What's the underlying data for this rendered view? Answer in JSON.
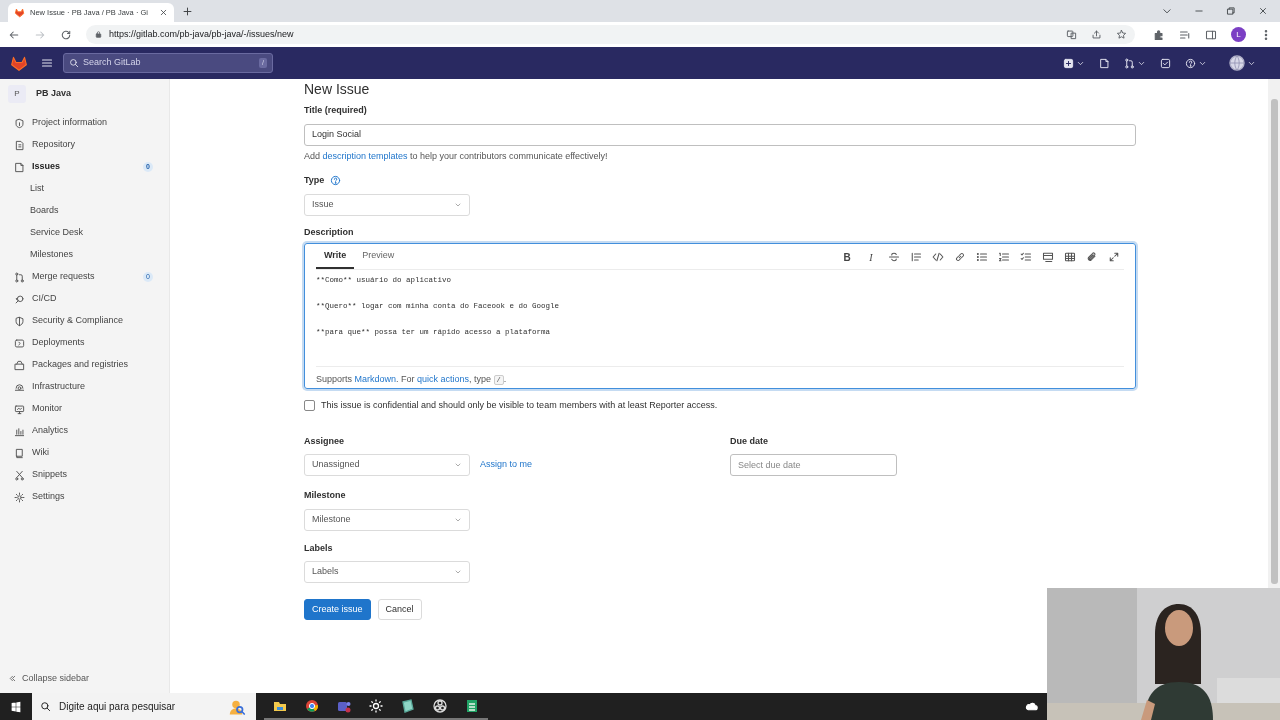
{
  "browser": {
    "tab_title": "New Issue · PB Java / PB Java · Gi",
    "url": "https://gitlab.com/pb-java/pb-java/-/issues/new",
    "profile_initial": "L"
  },
  "header": {
    "search_placeholder": "Search GitLab",
    "search_shortcut": "/"
  },
  "sidebar": {
    "project_initial": "P",
    "project_name": "PB Java",
    "items": [
      {
        "label": "Project information",
        "selected": false
      },
      {
        "label": "Repository",
        "selected": false
      },
      {
        "label": "Issues",
        "selected": true,
        "badge": "0",
        "children": [
          {
            "label": "List",
            "selected": false
          },
          {
            "label": "Boards",
            "selected": false
          },
          {
            "label": "Service Desk",
            "selected": false
          },
          {
            "label": "Milestones",
            "selected": false
          }
        ]
      },
      {
        "label": "Merge requests",
        "selected": false,
        "badge": "0"
      },
      {
        "label": "CI/CD",
        "selected": false
      },
      {
        "label": "Security & Compliance",
        "selected": false
      },
      {
        "label": "Deployments",
        "selected": false
      },
      {
        "label": "Packages and registries",
        "selected": false
      },
      {
        "label": "Infrastructure",
        "selected": false
      },
      {
        "label": "Monitor",
        "selected": false
      },
      {
        "label": "Analytics",
        "selected": false
      },
      {
        "label": "Wiki",
        "selected": false
      },
      {
        "label": "Snippets",
        "selected": false
      },
      {
        "label": "Settings",
        "selected": false
      }
    ],
    "collapse": "Collapse sidebar"
  },
  "page": {
    "heading": "New Issue",
    "title": {
      "label": "Title (required)",
      "value": "Login Social"
    },
    "hint": [
      {
        "text": "Add "
      },
      {
        "text": "description templates",
        "link": true
      },
      {
        "text": " to help your contributors communicate effectively!"
      }
    ],
    "type": {
      "label": "Type",
      "value": "Issue"
    },
    "description": {
      "label": "Description",
      "tabs": [
        {
          "label": "Write",
          "selected": true
        },
        {
          "label": "Preview",
          "selected": false
        }
      ],
      "format_buttons": [
        {
          "kind": "bold",
          "label": "B"
        },
        {
          "kind": "italic",
          "label": "I"
        }
      ],
      "paragraphs": [
        "**Como** usuário do aplicativo",
        "**Quero** logar com minha conta do Faceook e do Google",
        "**para que** possa ter um rápido acesso a plataforma"
      ],
      "footer": [
        {
          "text": "Supports "
        },
        {
          "text": "Markdown",
          "link": true
        },
        {
          "text": ". For "
        },
        {
          "text": "quick actions",
          "link": true
        },
        {
          "text": ", type "
        },
        {
          "text": "/",
          "kbd": true
        },
        {
          "text": "."
        }
      ]
    },
    "confidential": {
      "label": "This issue is confidential and should only be visible to team members with at least Reporter access.",
      "checked": false
    },
    "assignee": {
      "label": "Assignee",
      "value": "Unassigned",
      "assign_link": "Assign to me"
    },
    "due_date": {
      "label": "Due date",
      "placeholder": "Select due date"
    },
    "milestone": {
      "label": "Milestone",
      "value": "Milestone"
    },
    "labels": {
      "label": "Labels",
      "value": "Labels"
    },
    "buttons": [
      {
        "kind": "primary",
        "label": "Create issue"
      },
      {
        "kind": "secondary",
        "label": "Cancel"
      }
    ]
  },
  "taskbar": {
    "search_placeholder": "Digite aqui para pesquisar"
  }
}
